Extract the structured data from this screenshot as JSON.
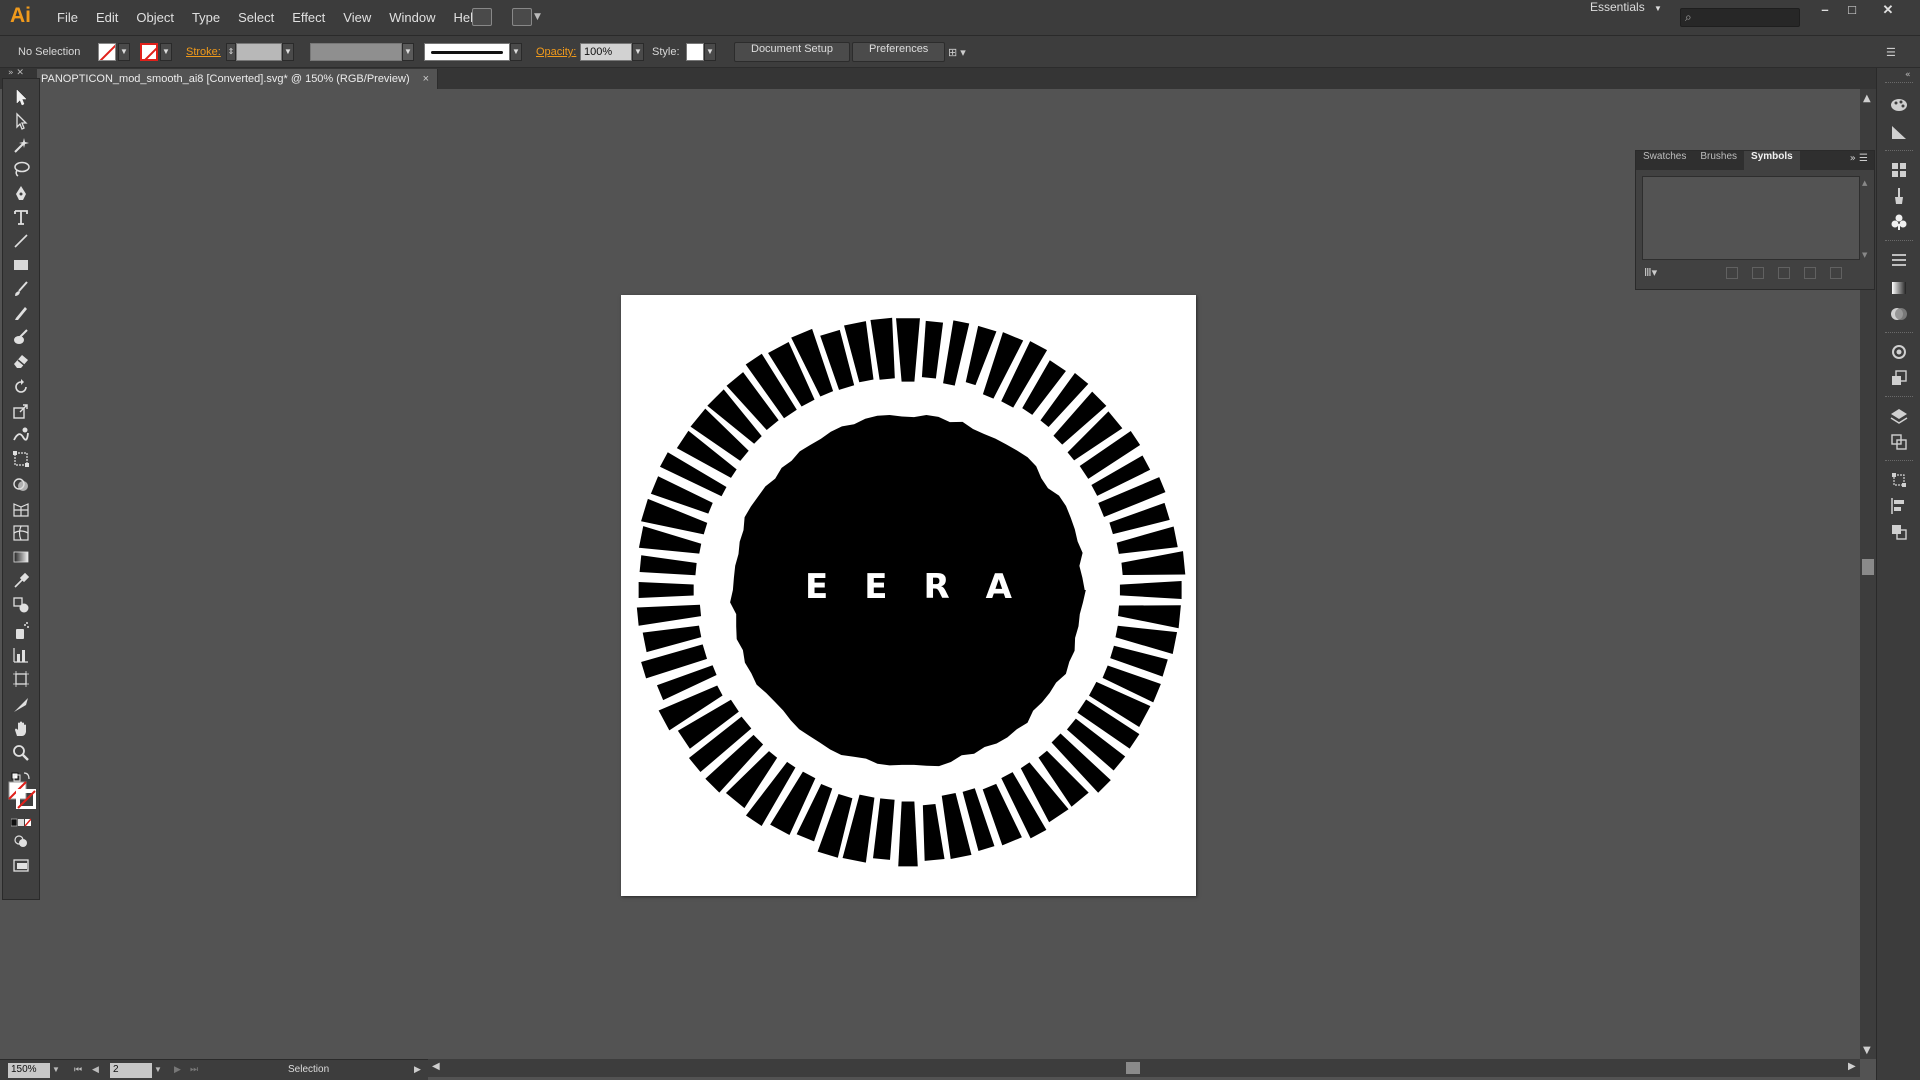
{
  "app": {
    "logo": "Ai"
  },
  "menu": [
    "File",
    "Edit",
    "Object",
    "Type",
    "Select",
    "Effect",
    "View",
    "Window",
    "Help"
  ],
  "workspace": {
    "label": "Essentials"
  },
  "control_bar": {
    "selection_status": "No Selection",
    "stroke_label": "Stroke:",
    "opacity_label": "Opacity:",
    "opacity_value": "100%",
    "style_label": "Style:",
    "document_setup_label": "Document Setup",
    "preferences_label": "Preferences"
  },
  "document": {
    "tab_title": "PANOPTICON_mod_smooth_ai8 [Converted].svg* @ 150% (RGB/Preview)",
    "close_glyph": "×"
  },
  "artwork": {
    "text": "EERA",
    "spokes": 64,
    "ink_color": "#000000",
    "paper_color": "#ffffff"
  },
  "symbols_panel": {
    "tabs": [
      "Swatches",
      "Brushes",
      "Symbols"
    ],
    "active_tab": "Symbols"
  },
  "status_bar": {
    "zoom": "150%",
    "artboard_number": "2",
    "current_tool": "Selection"
  },
  "colors": {
    "accent": "#f09a1c",
    "ui_dark": "#3c3c3c",
    "canvas": "#535353"
  }
}
